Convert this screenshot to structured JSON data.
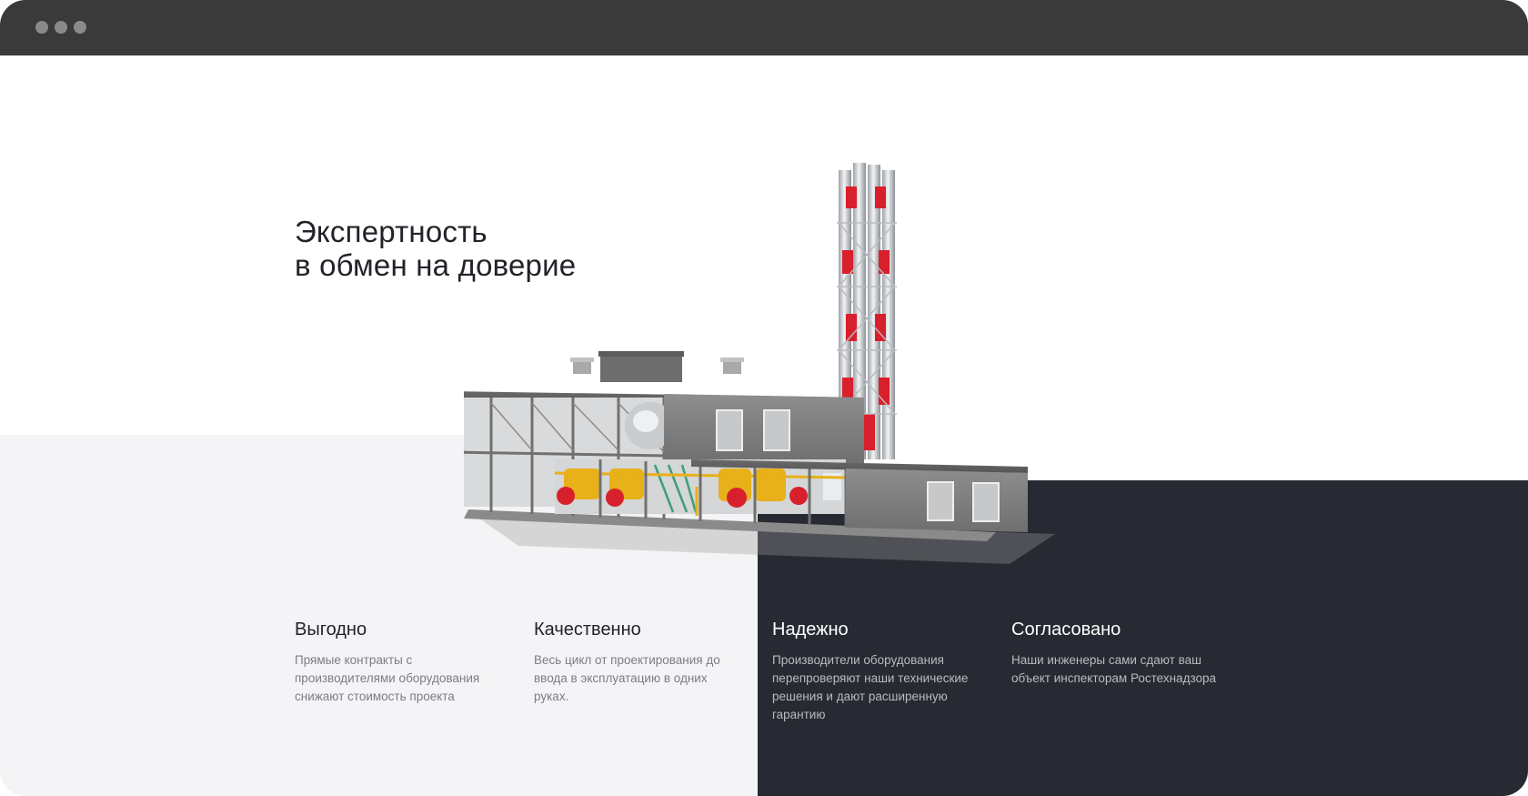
{
  "window": {
    "controls": [
      "dot",
      "dot",
      "dot"
    ]
  },
  "hero": {
    "heading_line1": "Экспертность",
    "heading_line2": "в обмен на доверие"
  },
  "illustration": {
    "subject": "industrial boiler house 3D model"
  },
  "features": [
    {
      "title": "Выгодно",
      "text": "Прямые контракты с производителями оборудования снижают стоимость проекта"
    },
    {
      "title": "Качественно",
      "text": "Весь цикл от проектирования до ввода в эксплуатацию в одних руках."
    },
    {
      "title": "Надежно",
      "text": "Производители оборудования перепроверяют наши технические решения и дают расширенную гарантию"
    },
    {
      "title": "Согласовано",
      "text": "Наши инженеры сами сдают ваш объект инспекторам Ростехнадзора"
    }
  ],
  "colors": {
    "titlebar": "#3a3a3a",
    "light_panel": "#f4f4f6",
    "dark_panel": "#272a32",
    "accent_red": "#d8202c",
    "accent_yellow": "#e8b019"
  }
}
